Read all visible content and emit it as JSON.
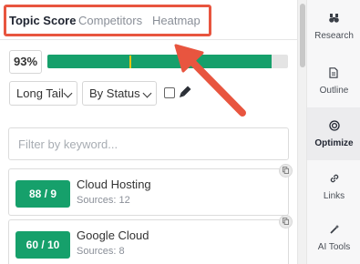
{
  "tabs": [
    {
      "label": "Topic Score",
      "active": true
    },
    {
      "label": "Competitors",
      "active": false
    },
    {
      "label": "Heatmap",
      "active": false
    }
  ],
  "score": {
    "percent_label": "93%",
    "bar_fill_fraction": 0.93,
    "marker_fraction": 0.34
  },
  "filters": {
    "type_select": "Long Tail",
    "status_select": "By Status"
  },
  "search": {
    "placeholder": "Filter by keyword..."
  },
  "topics": [
    {
      "score": "88 / 9",
      "name": "Cloud Hosting",
      "sources": "Sources: 12"
    },
    {
      "score": "60 / 10",
      "name": "Google Cloud",
      "sources": "Sources: 8"
    }
  ],
  "sidebar": {
    "items": [
      {
        "label": "Research",
        "icon": "binoculars-icon"
      },
      {
        "label": "Outline",
        "icon": "document-icon"
      },
      {
        "label": "Optimize",
        "icon": "target-icon",
        "active": true
      },
      {
        "label": "Links",
        "icon": "link-icon"
      },
      {
        "label": "AI Tools",
        "icon": "magic-wand-icon"
      }
    ]
  },
  "colors": {
    "accent_green": "#16a06b",
    "annotation_red": "#e8553f",
    "marker_yellow": "#f1c40f"
  }
}
